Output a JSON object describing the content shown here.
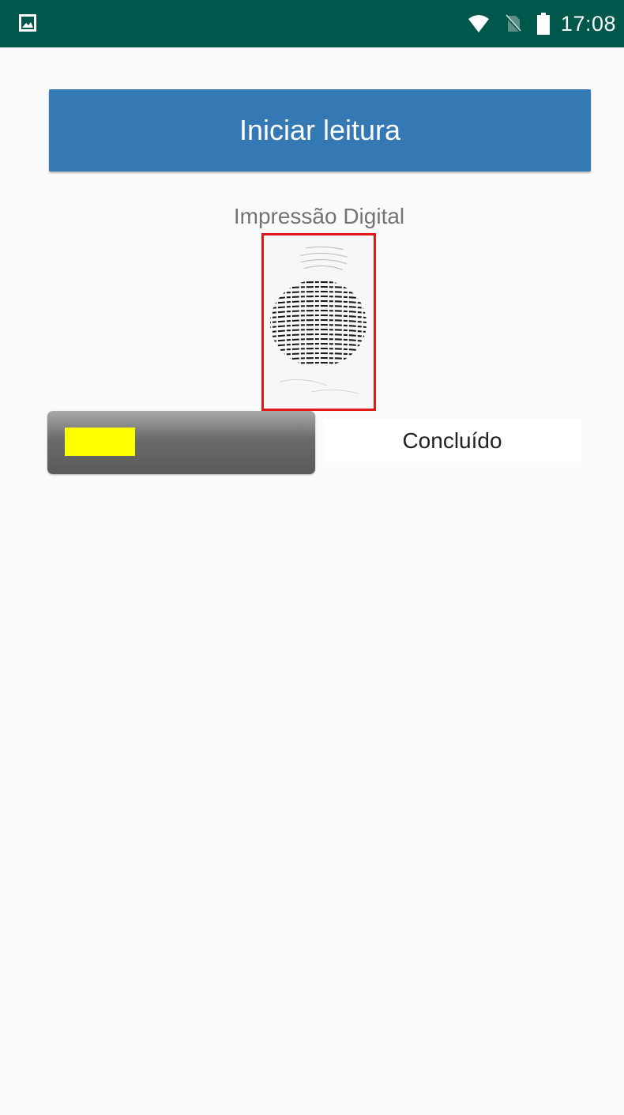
{
  "status_bar": {
    "time": "17:08",
    "background_color": "#00574b",
    "left_icon": "gallery-icon",
    "right_icons": [
      "wifi-icon",
      "no-sim-icon",
      "battery-icon"
    ]
  },
  "main": {
    "start_button_label": "Iniciar leitura",
    "button_color": "#3478b4",
    "fingerprint_label": "Impressão Digital",
    "fingerprint_image_icon": "fingerprint-image",
    "frame_color": "#e01818",
    "progress": {
      "fraction": 0.3,
      "fill_color": "#ffff00"
    },
    "status_text": "Concluído"
  }
}
